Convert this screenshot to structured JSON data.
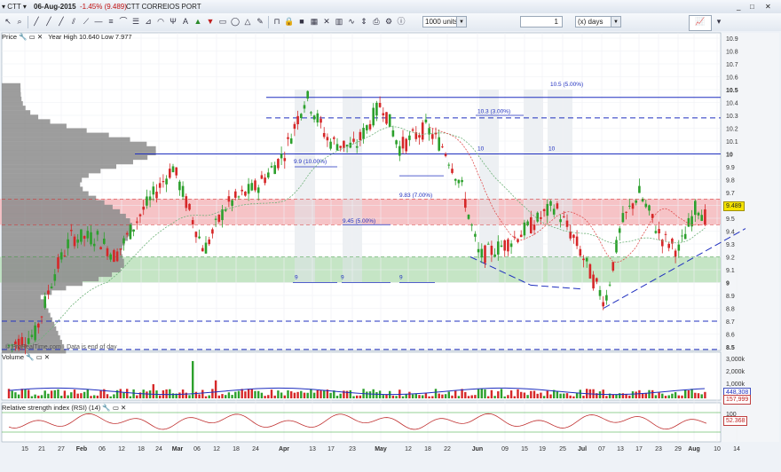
{
  "titlebar": {
    "symbol": "CTT",
    "date": "06-Aug-2015",
    "change": "-1.45% (9.489)",
    "name": "CTT CORREIOS PORT"
  },
  "toolbar": {
    "units_value": "1000 units",
    "period_value": "1",
    "period_unit": "(x) days"
  },
  "price_panel": {
    "label": "Price",
    "range_text": "Year High 10.640 Low 7.977",
    "y_ticks": [
      "10.9",
      "10.8",
      "10.7",
      "10.6",
      "10.5",
      "10.4",
      "10.3",
      "10.2",
      "10.1",
      "10",
      "9.9",
      "9.8",
      "9.7",
      "9.6",
      "9.5",
      "9.4",
      "9.3",
      "9.2",
      "9.1",
      "9",
      "8.9",
      "8.8",
      "8.7",
      "8.6",
      "8.5"
    ],
    "current_price": "9.489",
    "annotations": [
      "10.5 (5.00%)",
      "10.3 (3.00%)",
      "10",
      "10",
      "9.9 (10.00%)",
      "9.83 (7.00%)",
      "9.45 (5.00%)",
      "9",
      "9",
      "9"
    ],
    "footer": "© ProRealTime.com · Data is end of day"
  },
  "volume_panel": {
    "label": "Volume",
    "y_ticks": [
      "3,000k",
      "2,000k",
      "1,000k"
    ],
    "val1": "448,308",
    "val2": "157,999"
  },
  "rsi_panel": {
    "label": "Relative strength index (RSI) (14)",
    "y_top": "100",
    "value": "52.368"
  },
  "x_axis": {
    "labels": [
      {
        "t": "15",
        "x": 28
      },
      {
        "t": "21",
        "x": 47
      },
      {
        "t": "27",
        "x": 69
      },
      {
        "t": "Feb",
        "x": 92
      },
      {
        "t": "06",
        "x": 115
      },
      {
        "t": "12",
        "x": 137
      },
      {
        "t": "18",
        "x": 159
      },
      {
        "t": "24",
        "x": 179
      },
      {
        "t": "Mar",
        "x": 200
      },
      {
        "t": "06",
        "x": 222
      },
      {
        "t": "12",
        "x": 244
      },
      {
        "t": "18",
        "x": 266
      },
      {
        "t": "24",
        "x": 288
      },
      {
        "t": "Apr",
        "x": 320
      },
      {
        "t": "13",
        "x": 352
      },
      {
        "t": "17",
        "x": 373
      },
      {
        "t": "23",
        "x": 397
      },
      {
        "t": "May",
        "x": 429
      },
      {
        "t": "12",
        "x": 460
      },
      {
        "t": "18",
        "x": 482
      },
      {
        "t": "22",
        "x": 504
      },
      {
        "t": "Jun",
        "x": 538
      },
      {
        "t": "09",
        "x": 569
      },
      {
        "t": "15",
        "x": 591
      },
      {
        "t": "19",
        "x": 611
      },
      {
        "t": "25",
        "x": 634
      },
      {
        "t": "Jul",
        "x": 656
      },
      {
        "t": "07",
        "x": 678
      },
      {
        "t": "13",
        "x": 699
      },
      {
        "t": "17",
        "x": 720
      },
      {
        "t": "23",
        "x": 742
      },
      {
        "t": "29",
        "x": 764
      },
      {
        "t": "Aug",
        "x": 782
      },
      {
        "t": "10",
        "x": 808
      },
      {
        "t": "14",
        "x": 830
      }
    ]
  },
  "colors": {
    "up": "#2ca02c",
    "down": "#d62728",
    "red_zone": "#f4b4b8",
    "green_zone": "#b7dfb7",
    "blue_line": "#1f2fbf"
  }
}
